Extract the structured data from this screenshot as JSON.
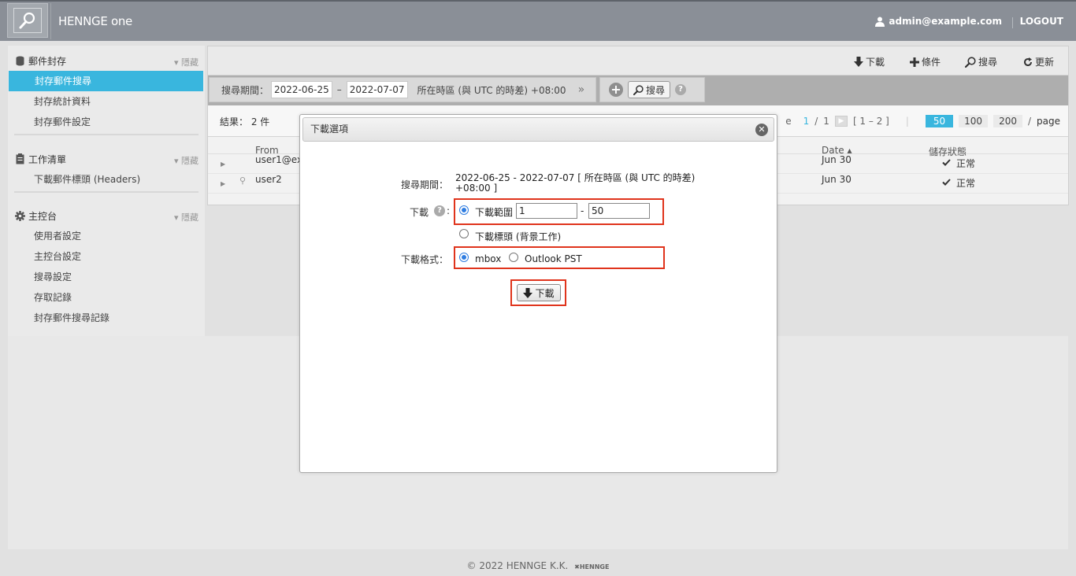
{
  "header": {
    "brand": "HENNGE one",
    "user": "admin@example.com",
    "logout": "LOGOUT"
  },
  "sidebar": {
    "sections": [
      {
        "title": "郵件封存",
        "hide": "隱藏",
        "items": [
          "封存郵件搜尋",
          "封存統計資料",
          "封存郵件設定"
        ]
      },
      {
        "title": "工作清單",
        "hide": "隱藏",
        "items": [
          "下載郵件標頭 (Headers)"
        ]
      },
      {
        "title": "主控台",
        "hide": "隱藏",
        "items": [
          "使用者設定",
          "主控台設定",
          "搜尋設定",
          "存取記錄",
          "封存郵件搜尋記錄"
        ]
      }
    ]
  },
  "toolbar": {
    "download": "下載",
    "conditions": "條件",
    "search": "搜尋",
    "refresh": "更新"
  },
  "searchbar": {
    "period_label": "搜尋期間：",
    "date_from": "2022-06-25",
    "date_sep": "–",
    "date_to": "2022-07-07",
    "timezone": "所在時區 (與 UTC 的時差) +08:00",
    "more": "»",
    "search_button": "搜尋"
  },
  "results": {
    "count": "結果： 2 件",
    "pager": {
      "e": "e",
      "current": "1",
      "slash": "/",
      "total": "1",
      "range": "[ 1 – 2 ]",
      "sizes": [
        "50",
        "100",
        "200"
      ],
      "per": "/",
      "page": "page"
    }
  },
  "table": {
    "headers": {
      "from": "From",
      "date": "Date ▴",
      "status": "儲存狀態"
    },
    "rows": [
      {
        "from": "user1@ex",
        "date": "Jun 30",
        "status": "正常"
      },
      {
        "from": "user2",
        "date": "Jun 30",
        "status": "正常"
      }
    ]
  },
  "dialog": {
    "title": "下載選項",
    "period_label": "搜尋期間：",
    "period_value_line1": "2022-06-25 - 2022-07-07 [ 所在時區 (與 UTC 的時差)",
    "period_value_line2": "+08:00 ]",
    "download_label": "下載",
    "range_label": "下載範圍",
    "range_from": "1",
    "range_sep": "-",
    "range_to": "50",
    "headers_label": "下載標頭 (背景工作)",
    "format_label": "下載格式：",
    "format_mbox": "mbox",
    "format_pst": "Outlook PST",
    "download_button": "下載"
  },
  "footer": {
    "copyright": "© 2022 HENNGE K.K.",
    "logo": "HENNGE"
  },
  "colors": {
    "accent": "#39b6de",
    "highlight": "#e0341c",
    "header_bg": "#8a8f97"
  }
}
